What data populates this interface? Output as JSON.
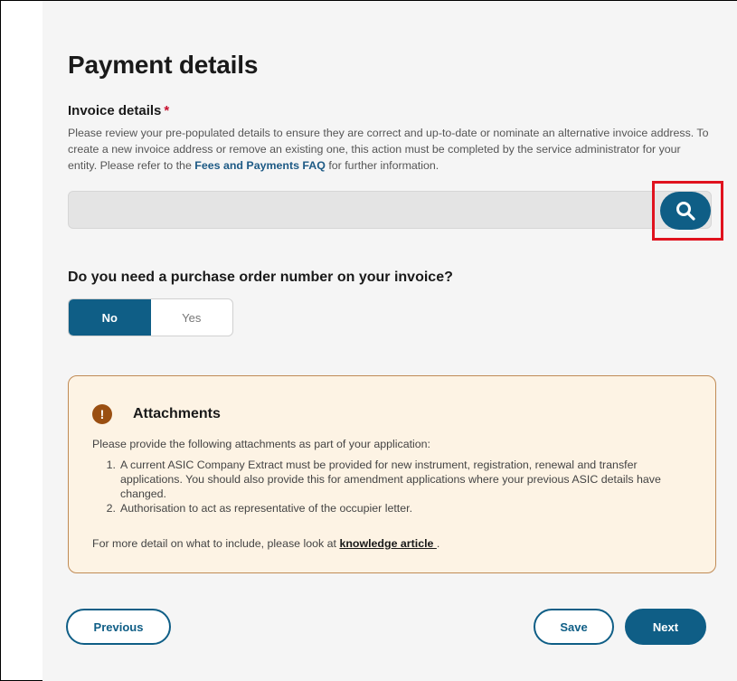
{
  "page": {
    "title": "Payment details"
  },
  "invoice": {
    "label": "Invoice details",
    "required_marker": "*",
    "help_text_before": "Please review your pre-populated details to ensure they are correct and up-to-date or nominate an alternative invoice address. To create a new invoice address or remove an existing one, this action must be completed by the service administrator for your entity. Please refer to the ",
    "help_link": "Fees and Payments FAQ",
    "help_text_after": " for further information.",
    "input_value": "",
    "search_icon": "search-icon"
  },
  "purchase_order": {
    "question": "Do you need a purchase order number on your invoice?",
    "options": [
      "No",
      "Yes"
    ],
    "selected": "No"
  },
  "attachments": {
    "icon": "warning-icon",
    "icon_glyph": "!",
    "title": "Attachments",
    "intro": "Please provide the following attachments as part of your application:",
    "items": [
      {
        "num": "1.",
        "text": "A current ASIC Company Extract must be provided for new instrument, registration, renewal and transfer applications. You should also provide this for amendment applications where your previous ASIC details have changed."
      },
      {
        "num": "2.",
        "text": "Authorisation to act as representative of the occupier letter."
      }
    ],
    "more_before": "For more detail on what to include, please look at ",
    "more_link": "knowledge article ",
    "more_after": "."
  },
  "buttons": {
    "previous": "Previous",
    "save": "Save",
    "next": "Next"
  },
  "colors": {
    "primary": "#0f5e86",
    "highlight": "#e0121e",
    "attachment_bg": "#fdf3e4",
    "attachment_border": "#c08b55",
    "warning_icon": "#9a4f12"
  }
}
